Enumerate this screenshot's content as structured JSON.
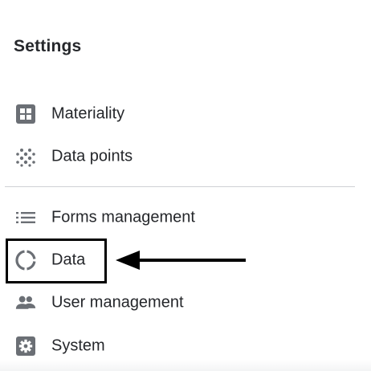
{
  "sidebar": {
    "title": "Settings",
    "items": [
      {
        "label": "Materiality",
        "icon": "grid-square-icon"
      },
      {
        "label": "Data points",
        "icon": "dots-icon"
      },
      {
        "label": "Forms management",
        "icon": "list-icon"
      },
      {
        "label": "Data",
        "icon": "circle-segments-icon",
        "highlighted": true
      },
      {
        "label": "User management",
        "icon": "people-icon"
      },
      {
        "label": "System",
        "icon": "gear-icon"
      }
    ]
  },
  "colors": {
    "icon": "#6b6f75",
    "text": "#25272b",
    "divider": "#cfd1d4",
    "annotation": "#000000"
  }
}
